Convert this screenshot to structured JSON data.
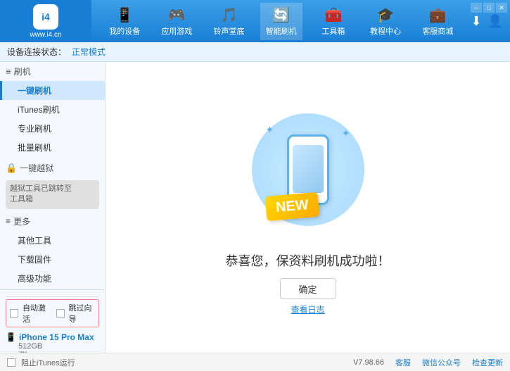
{
  "app": {
    "logo_abbr": "i4",
    "logo_url": "www.i4.cn"
  },
  "nav": {
    "items": [
      {
        "id": "my-device",
        "icon": "📱",
        "label": "我的设备"
      },
      {
        "id": "apps-games",
        "icon": "🎮",
        "label": "应用游戏"
      },
      {
        "id": "ringtone",
        "icon": "🎵",
        "label": "铃声堂底"
      },
      {
        "id": "smart-flash",
        "icon": "🔄",
        "label": "智能刷机",
        "active": true
      },
      {
        "id": "toolbox",
        "icon": "🧰",
        "label": "工具箱"
      },
      {
        "id": "tutorial",
        "icon": "🎓",
        "label": "教程中心"
      },
      {
        "id": "service",
        "icon": "💼",
        "label": "客服商城"
      }
    ]
  },
  "breadcrumb": {
    "base": "设备连接状态：",
    "status": "正常模式"
  },
  "sidebar": {
    "section_flash": "刷机",
    "items_flash": [
      {
        "id": "one-key-flash",
        "label": "一键刷机",
        "active": true
      },
      {
        "id": "itunes-flash",
        "label": "iTunes刷机"
      },
      {
        "id": "pro-flash",
        "label": "专业刷机"
      },
      {
        "id": "batch-flash",
        "label": "批量刷机"
      }
    ],
    "section_one_key": "一键越狱",
    "jailbreak_note": "越狱工具已跳转至\n工具箱",
    "section_more": "更多",
    "items_more": [
      {
        "id": "other-tools",
        "label": "其他工具"
      },
      {
        "id": "download-firmware",
        "label": "下载固件"
      },
      {
        "id": "advanced",
        "label": "高级功能"
      }
    ]
  },
  "device": {
    "name": "iPhone 15 Pro Max",
    "storage": "512GB",
    "type": "iPhone",
    "autodetect_label": "自动激活",
    "redirect_label": "跳过向导"
  },
  "content": {
    "new_badge": "NEW",
    "success_text": "恭喜您，保资料刷机成功啦！",
    "confirm_btn": "确定",
    "log_link": "查看日志"
  },
  "footer": {
    "itunes_label": "阻止iTunes运行",
    "version": "V7.98.66",
    "server_label": "客服",
    "wechat_label": "微信公众号",
    "refresh_label": "检查更新"
  },
  "window_controls": {
    "min": "─",
    "max": "□",
    "close": "✕"
  }
}
